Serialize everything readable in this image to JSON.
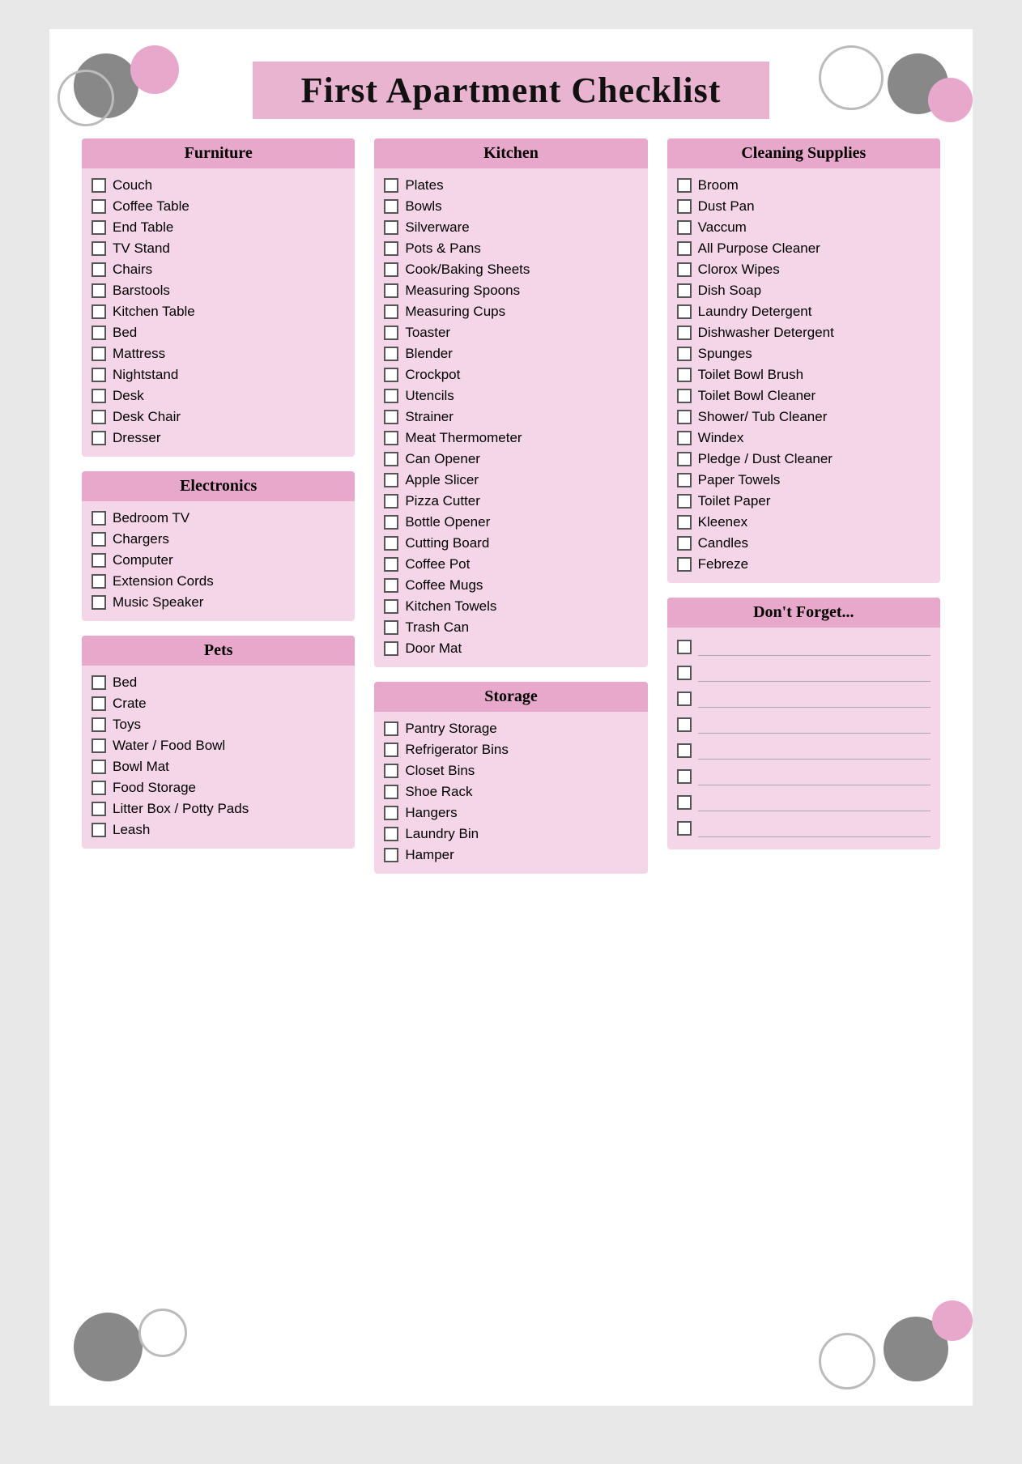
{
  "title": "First Apartment Checklist",
  "sections": {
    "furniture": {
      "header": "Furniture",
      "items": [
        "Couch",
        "Coffee Table",
        "End Table",
        "TV Stand",
        "Chairs",
        "Barstools",
        "Kitchen Table",
        "Bed",
        "Mattress",
        "Nightstand",
        "Desk",
        "Desk Chair",
        "Dresser"
      ]
    },
    "electronics": {
      "header": "Electronics",
      "items": [
        "Bedroom TV",
        "Chargers",
        "Computer",
        "Extension Cords",
        "Music Speaker"
      ]
    },
    "pets": {
      "header": "Pets",
      "items": [
        "Bed",
        "Crate",
        "Toys",
        "Water / Food Bowl",
        "Bowl Mat",
        "Food Storage",
        "Litter Box / Potty Pads",
        "Leash"
      ]
    },
    "kitchen": {
      "header": "Kitchen",
      "items": [
        "Plates",
        "Bowls",
        "Silverware",
        "Pots & Pans",
        "Cook/Baking Sheets",
        "Measuring Spoons",
        "Measuring Cups",
        "Toaster",
        "Blender",
        "Crockpot",
        "Utencils",
        "Strainer",
        "Meat Thermometer",
        "Can Opener",
        "Apple Slicer",
        "Pizza Cutter",
        "Bottle Opener",
        "Cutting Board",
        "Coffee Pot",
        "Coffee Mugs",
        "Kitchen Towels",
        "Trash Can",
        "Door Mat"
      ]
    },
    "storage": {
      "header": "Storage",
      "items": [
        "Pantry Storage",
        "Refrigerator Bins",
        "Closet Bins",
        "Shoe Rack",
        "Hangers",
        "Laundry Bin",
        "Hamper"
      ]
    },
    "cleaning": {
      "header": "Cleaning Supplies",
      "items": [
        "Broom",
        "Dust Pan",
        "Vaccum",
        "All Purpose Cleaner",
        "Clorox Wipes",
        "Dish Soap",
        "Laundry Detergent",
        "Dishwasher Detergent",
        "Spunges",
        "Toilet Bowl Brush",
        "Toilet Bowl Cleaner",
        "Shower/ Tub Cleaner",
        "Windex",
        "Pledge / Dust Cleaner",
        "Paper Towels",
        "Toilet Paper",
        "Kleenex",
        "Candles",
        "Febreze"
      ]
    },
    "dont_forget": {
      "header": "Don't Forget...",
      "blank_count": 8
    }
  }
}
